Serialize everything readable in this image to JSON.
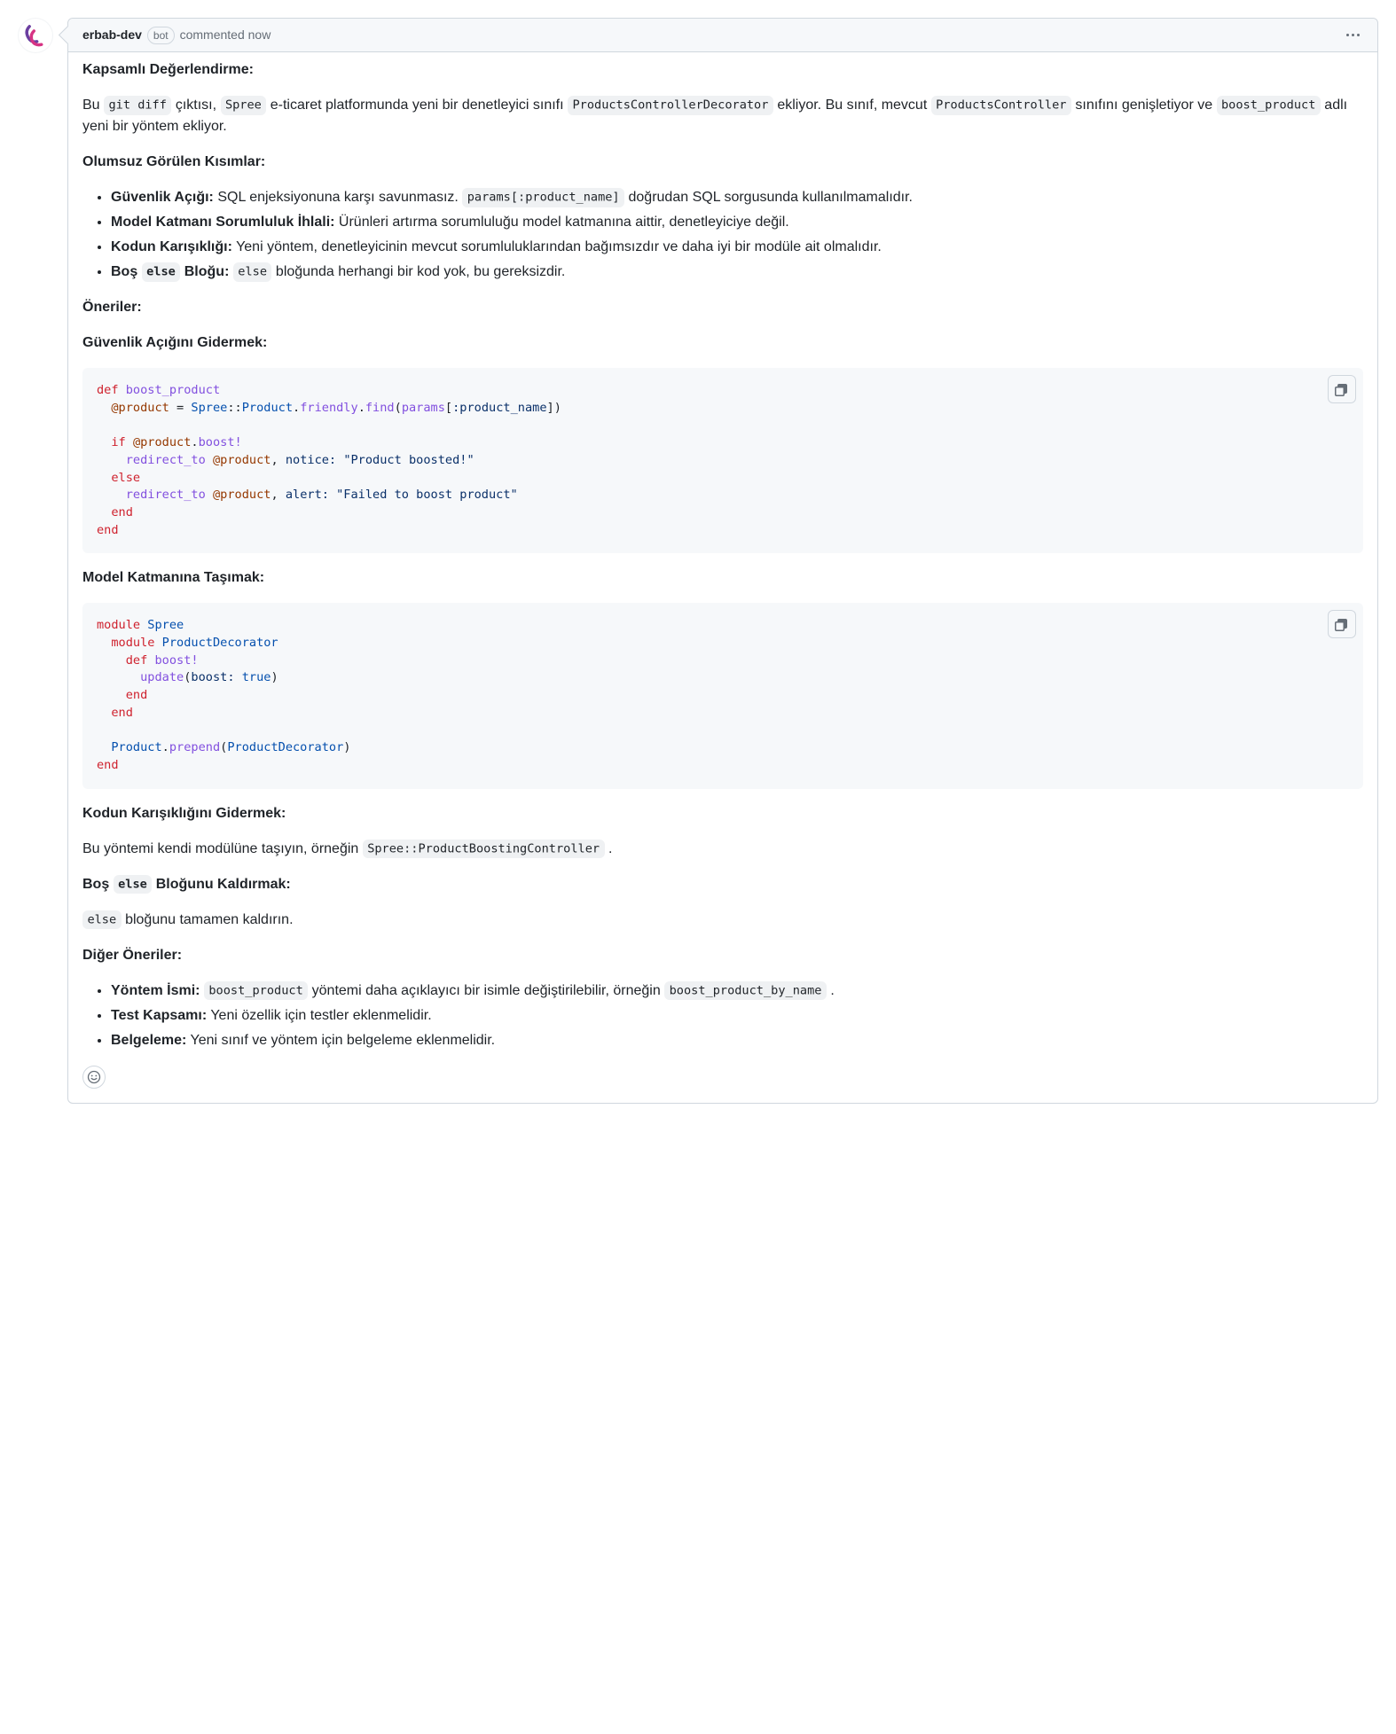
{
  "header": {
    "author": "erbab-dev",
    "bot_label": "bot",
    "timestamp_text": "commented now"
  },
  "body": {
    "h_overall": "Kapsamlı Değerlendirme:",
    "p_intro_1": "Bu ",
    "p_intro_code1": "git diff",
    "p_intro_2": " çıktısı, ",
    "p_intro_code2": "Spree",
    "p_intro_3": " e-ticaret platformunda yeni bir denetleyici sınıfı ",
    "p_intro_code3": "ProductsControllerDecorator",
    "p_intro_4": " ekliyor. Bu sınıf, mevcut ",
    "p_intro_code4": "ProductsController",
    "p_intro_5": " sınıfını genişletiyor ve ",
    "p_intro_code5": "boost_product",
    "p_intro_6": " adlı yeni bir yöntem ekliyor.",
    "h_negatives": "Olumsuz Görülen Kısımlar:",
    "neg1_label": "Güvenlik Açığı:",
    "neg1_t1": " SQL enjeksiyonuna karşı savunmasız. ",
    "neg1_code": "params[:product_name]",
    "neg1_t2": " doğrudan SQL sorgusunda kullanılmamalıdır.",
    "neg2_label": "Model Katmanı Sorumluluk İhlali:",
    "neg2_t1": " Ürünleri artırma sorumluluğu model katmanına aittir, denetleyiciye değil.",
    "neg3_label": "Kodun Karışıklığı:",
    "neg3_t1": " Yeni yöntem, denetleyicinin mevcut sorumluluklarından bağımsızdır ve daha iyi bir modüle ait olmalıdır.",
    "neg4_label_1": "Boş ",
    "neg4_code": "else",
    "neg4_label_2": " Bloğu:",
    "neg4_t1": " ",
    "neg4_code2": "else",
    "neg4_t2": " bloğunda herhangi bir kod yok, bu gereksizdir.",
    "h_suggestions": "Öneriler:",
    "h_fix_sec": "Güvenlik Açığını Gidermek:",
    "h_move_model": "Model Katmanına Taşımak:",
    "h_fix_mess": "Kodun Karışıklığını Gidermek:",
    "p_fix_mess_1": "Bu yöntemi kendi modülüne taşıyın, örneğin ",
    "p_fix_mess_code": "Spree::ProductBoostingController",
    "p_fix_mess_2": " .",
    "h_remove_else_1": "Boş ",
    "h_remove_else_code": "else",
    "h_remove_else_2": " Bloğunu Kaldırmak:",
    "p_remove_else_code": "else",
    "p_remove_else_t": " bloğunu tamamen kaldırın.",
    "h_other": "Diğer Öneriler:",
    "oth1_label": "Yöntem İsmi:",
    "oth1_t1": " ",
    "oth1_code1": "boost_product",
    "oth1_t2": " yöntemi daha açıklayıcı bir isimle değiştirilebilir, örneğin ",
    "oth1_code2": "boost_product_by_name",
    "oth1_t3": " .",
    "oth2_label": "Test Kapsamı:",
    "oth2_t1": " Yeni özellik için testler eklenmelidir.",
    "oth3_label": "Belgeleme:",
    "oth3_t1": " Yeni sınıf ve yöntem için belgeleme eklenmelidir."
  },
  "code_blocks": {
    "block1": {
      "l1_kw": "def",
      "l1_fn": "boost_product",
      "l2_var": "@product",
      "l2_eq": " = ",
      "l2_c1": "Spree",
      "l2_p1": "::",
      "l2_c2": "Product",
      "l2_p2": ".",
      "l2_m1": "friendly",
      "l2_p3": ".",
      "l2_m2": "find",
      "l2_p4": "(",
      "l2_m3": "params",
      "l2_p5": "[",
      "l2_sym": ":product_name",
      "l2_p6": "])",
      "l3_kw": "if",
      "l3_var": "@product",
      "l3_p": ".",
      "l3_m": "boost!",
      "l4_m": "redirect_to",
      "l4_var": "@product",
      "l4_p": ", ",
      "l4_sym": "notice:",
      "l4_str": "\"Product boosted!\"",
      "l5_kw": "else",
      "l6_m": "redirect_to",
      "l6_var": "@product",
      "l6_p": ", ",
      "l6_sym": "alert:",
      "l6_str": "\"Failed to boost product\"",
      "l7_kw": "end",
      "l8_kw": "end"
    },
    "block2": {
      "l1_kw": "module",
      "l1_c": "Spree",
      "l2_kw": "module",
      "l2_c": "ProductDecorator",
      "l3_kw": "def",
      "l3_fn": "boost!",
      "l4_m": "update",
      "l4_p1": "(",
      "l4_sym": "boost:",
      "l4_v": "true",
      "l4_p2": ")",
      "l5_kw": "end",
      "l6_kw": "end",
      "l7_c": "Product",
      "l7_p1": ".",
      "l7_m": "prepend",
      "l7_p2": "(",
      "l7_c2": "ProductDecorator",
      "l7_p3": ")",
      "l8_kw": "end"
    }
  }
}
